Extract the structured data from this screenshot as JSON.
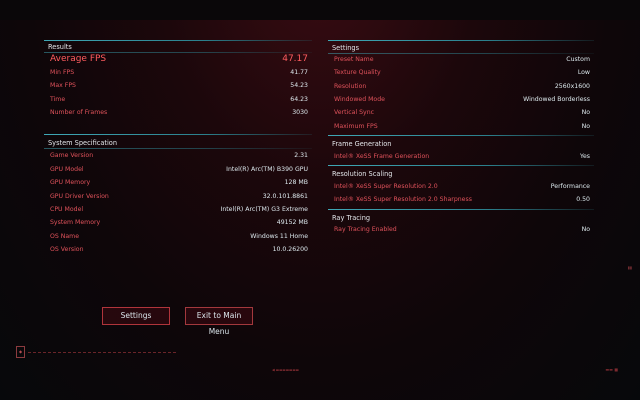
{
  "results": {
    "title": "Results",
    "average_fps_label": "Average FPS",
    "average_fps_value": "47.17",
    "rows": [
      {
        "label": "Min FPS",
        "value": "41.77"
      },
      {
        "label": "Max FPS",
        "value": "54.23"
      },
      {
        "label": "Time",
        "value": "64.23"
      },
      {
        "label": "Number of Frames",
        "value": "3030"
      }
    ]
  },
  "system": {
    "title": "System Specification",
    "rows": [
      {
        "label": "Game Version",
        "value": "2.31"
      },
      {
        "label": "GPU Model",
        "value": "Intel(R) Arc(TM) B390 GPU"
      },
      {
        "label": "GPU Memory",
        "value": "128 MB"
      },
      {
        "label": "GPU Driver Version",
        "value": "32.0.101.8861"
      },
      {
        "label": "CPU Model",
        "value": "Intel(R) Arc(TM) G3 Extreme"
      },
      {
        "label": "System Memory",
        "value": "49152 MB"
      },
      {
        "label": "OS Name",
        "value": "Windows 11 Home"
      },
      {
        "label": "OS Version",
        "value": "10.0.26200"
      }
    ]
  },
  "settings": {
    "title": "Settings",
    "rows": [
      {
        "label": "Preset Name",
        "value": "Custom"
      },
      {
        "label": "Texture Quality",
        "value": "Low"
      },
      {
        "label": "Resolution",
        "value": "2560x1600"
      },
      {
        "label": "Windowed Mode",
        "value": "Windowed Borderless"
      },
      {
        "label": "Vertical Sync",
        "value": "No"
      },
      {
        "label": "Maximum FPS",
        "value": "No"
      }
    ]
  },
  "frame_generation": {
    "title": "Frame Generation",
    "rows": [
      {
        "label": "Intel® XeSS Frame Generation",
        "value": "Yes"
      }
    ]
  },
  "resolution_scaling": {
    "title": "Resolution Scaling",
    "rows": [
      {
        "label": "Intel® XeSS Super Resolution 2.0",
        "value": "Performance"
      },
      {
        "label": "Intel® XeSS Super Resolution 2.0 Sharpness",
        "value": "0.50"
      }
    ]
  },
  "ray_tracing": {
    "title": "Ray Tracing",
    "rows": [
      {
        "label": "Ray Tracing Enabled",
        "value": "No"
      }
    ]
  },
  "buttons": {
    "settings_label": "Settings",
    "exit_label": "Exit to Main Menu"
  }
}
